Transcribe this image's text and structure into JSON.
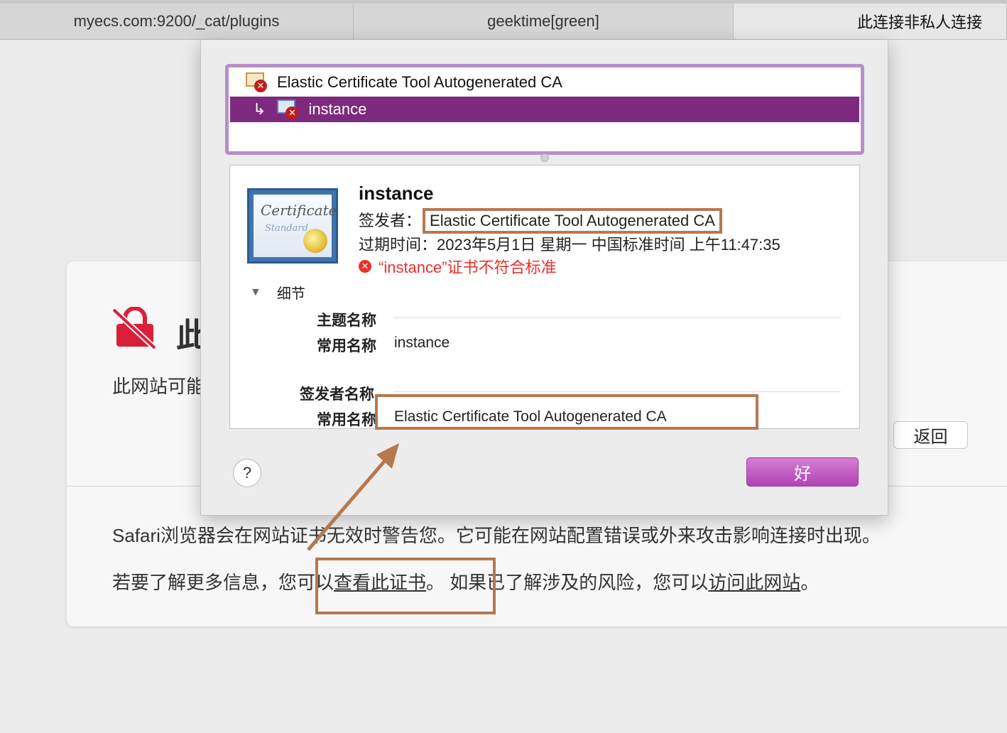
{
  "tabs": [
    {
      "label": "myecs.com:9200/_cat/plugins"
    },
    {
      "label": "geektime[green]"
    },
    {
      "label": "此连接非私人连接"
    }
  ],
  "warning": {
    "title_partial": "此",
    "desc_partial": "此网站可能",
    "back_label": "返回",
    "info_line1": "Safari浏览器会在网站证书无效时警告您。它可能在网站配置错误或外来攻击影响连接时出现。",
    "info_line2_prefix": "若要了解更多信息，您可以",
    "view_cert_link": "查看此证书",
    "info_line2_middle": "。 如果已了解涉及的风险，您可以",
    "visit_site_link": "访问此网站",
    "info_line2_suffix": "。"
  },
  "chain": {
    "root": "Elastic Certificate Tool Autogenerated CA",
    "leaf": "instance",
    "leaf_arrow": "↳"
  },
  "certificate": {
    "name": "instance",
    "issuer_label": "签发者：",
    "issuer_value": "Elastic Certificate Tool Autogenerated CA",
    "expiry": "过期时间：2023年5月1日 星期一 中国标准时间 上午11:47:35",
    "error": "“instance”证书不符合标准",
    "icon_text_1": "Certificate",
    "icon_text_2": "Standard"
  },
  "details": {
    "toggle_label": "细节",
    "subject_section": "主题名称",
    "subject_cn_label": "常用名称",
    "subject_cn_value": "instance",
    "issuer_section": "签发者名称",
    "issuer_cn_label": "常用名称",
    "issuer_cn_value": "Elastic Certificate Tool Autogenerated CA"
  },
  "buttons": {
    "help": "?",
    "ok": "好"
  },
  "colors": {
    "selection": "#7d2a7e",
    "chain_border": "#b78fcb",
    "annotation": "#b7784e",
    "error": "#e8312a",
    "ok_button": "#c060c4",
    "warning_lock": "#d9203a"
  }
}
